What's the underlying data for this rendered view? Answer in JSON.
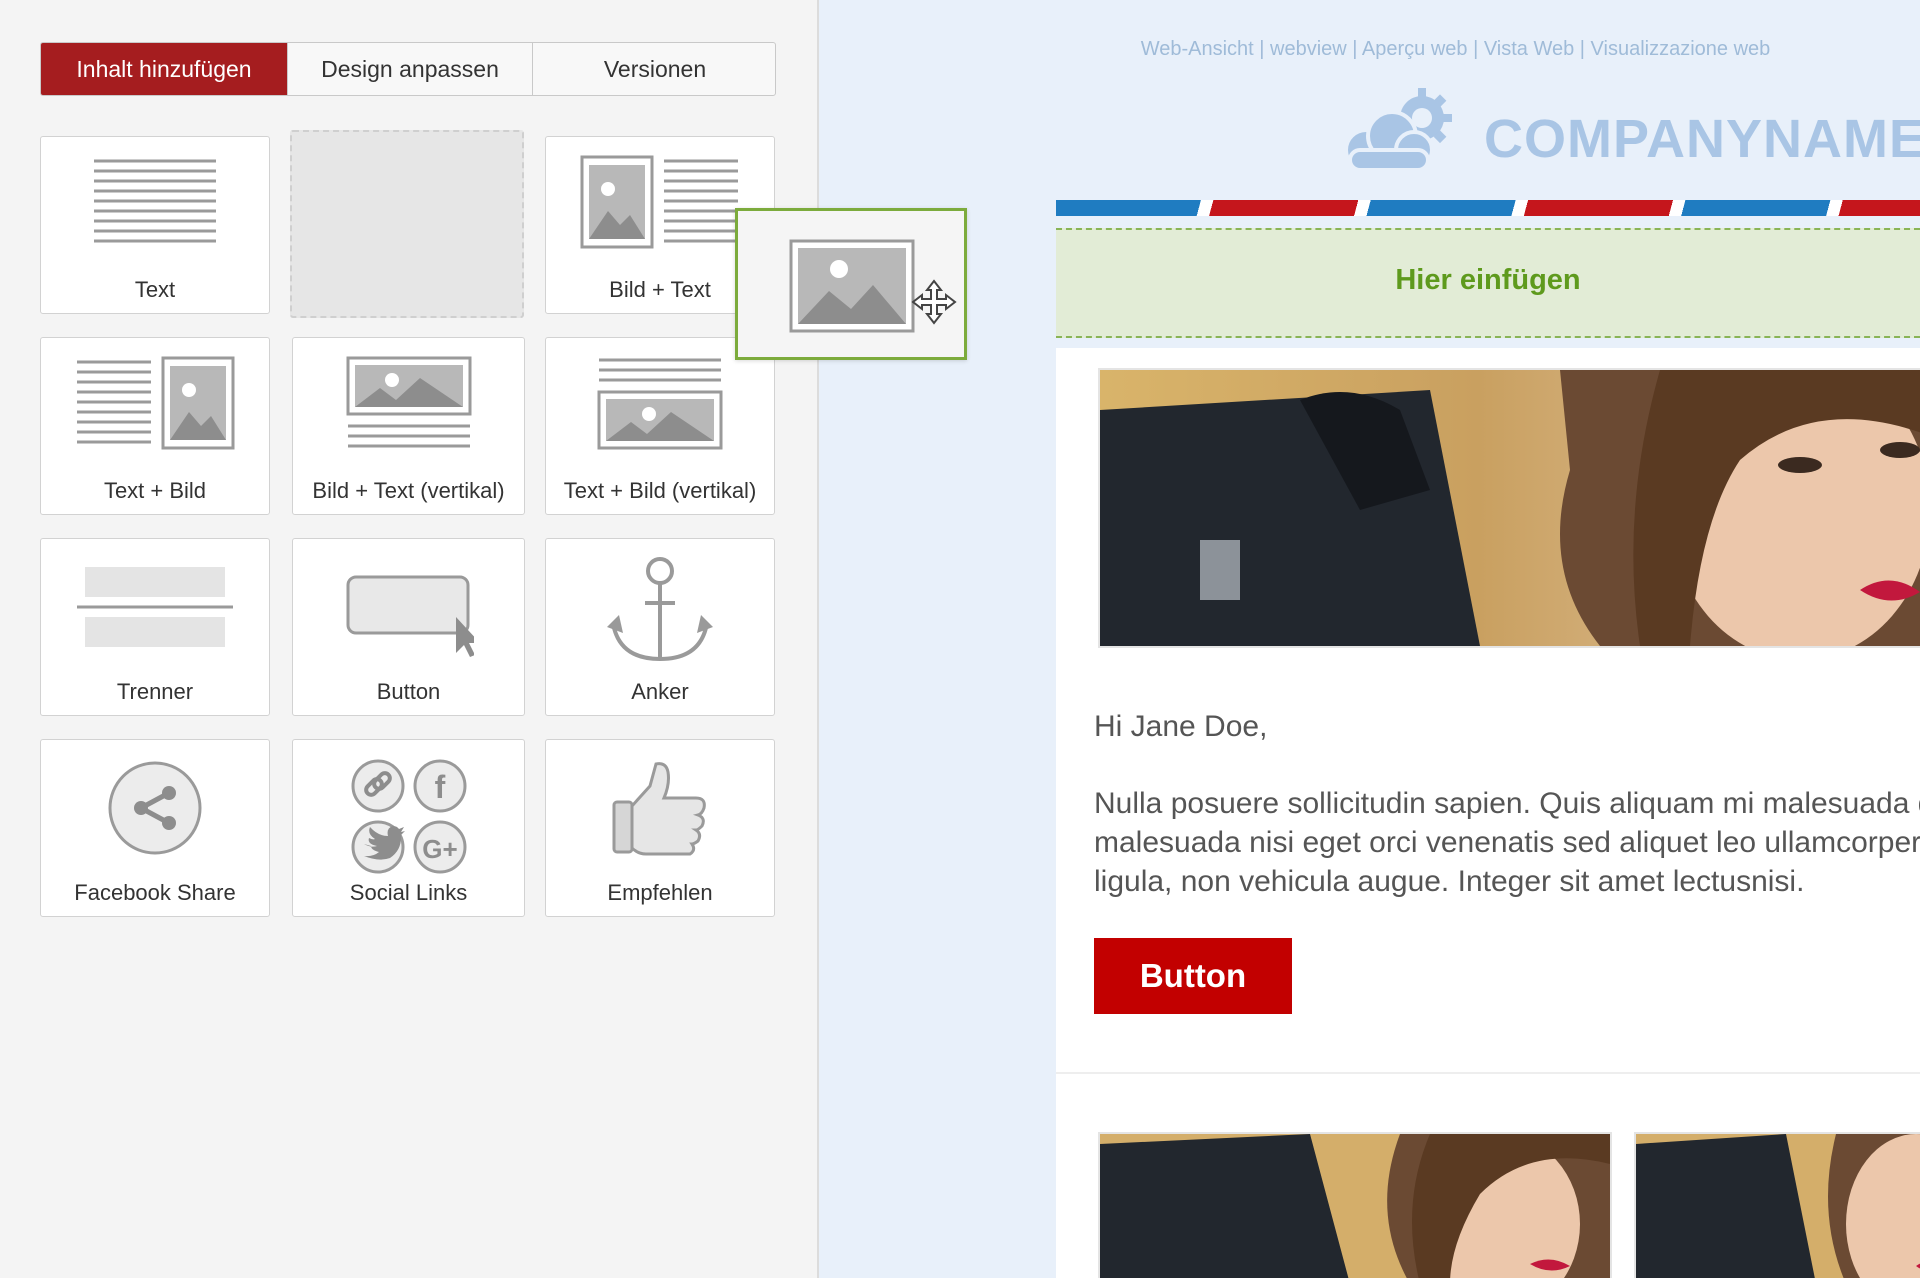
{
  "tabs": [
    {
      "label": "Inhalt hinzufügen",
      "active": true
    },
    {
      "label": "Design anpassen",
      "active": false
    },
    {
      "label": "Versionen",
      "active": false
    }
  ],
  "blocks": [
    {
      "label": "Text",
      "icon": "text-block-icon"
    },
    {
      "label": "",
      "icon": "empty-slot"
    },
    {
      "label": "Bild + Text",
      "icon": "image-text-icon"
    },
    {
      "label": "Text + Bild",
      "icon": "text-image-icon"
    },
    {
      "label": "Bild + Text (vertikal)",
      "icon": "image-text-vertical-icon"
    },
    {
      "label": "Text + Bild (vertikal)",
      "icon": "text-image-vertical-icon"
    },
    {
      "label": "Trenner",
      "icon": "divider-icon"
    },
    {
      "label": "Button",
      "icon": "button-icon"
    },
    {
      "label": "Anker",
      "icon": "anchor-icon"
    },
    {
      "label": "Facebook Share",
      "icon": "share-icon"
    },
    {
      "label": "Social Links",
      "icon": "social-links-icon"
    },
    {
      "label": "Empfehlen",
      "icon": "thumbs-up-icon"
    }
  ],
  "email": {
    "webview_links": "Web-Ansicht | webview | Aperçu web | Vista Web | Visualizzazione web",
    "company_name": "COMPANYNAME",
    "drop_zone_label": "Hier einfügen",
    "greeting": "Hi Jane Doe,",
    "body": "Nulla posuere sollicitudin sapien. Quis aliquam mi malesuada quis. Q\nmalesuada nisi eget orci venenatis sed aliquet leo ullamcorper. Fusce\nligula, non vehicula augue. Integer sit amet lectusnisi.",
    "button_label": "Button"
  },
  "drag": {
    "icon": "image-block-icon",
    "cursor": "move-cursor-icon"
  },
  "colors": {
    "accent": "#a51d1f",
    "drop_green": "#5e9a1d",
    "button_red": "#c20000",
    "logo_blue": "#a9c5e5"
  }
}
